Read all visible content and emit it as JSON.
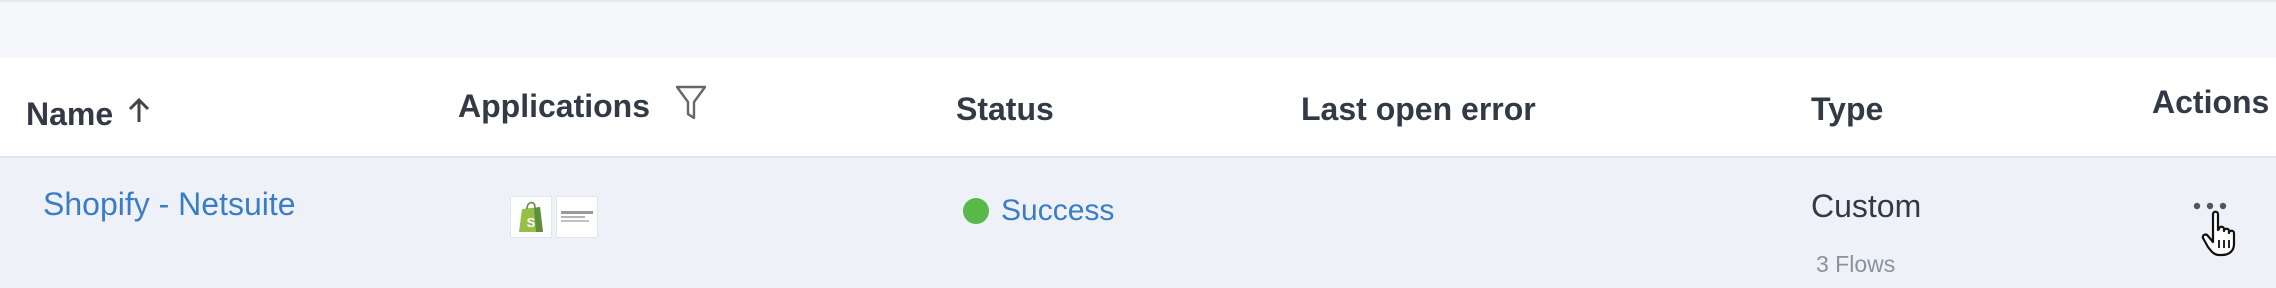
{
  "table": {
    "headers": {
      "name": "Name",
      "applications": "Applications",
      "status": "Status",
      "last_open_error": "Last open error",
      "type": "Type",
      "actions": "Actions"
    },
    "rows": [
      {
        "name": "Shopify - Netsuite",
        "applications": [
          "shopify-logo",
          "oracle-netsuite-logo"
        ],
        "status": "Success",
        "last_open_error": "",
        "type": "Custom",
        "flows": "3 Flows"
      }
    ]
  },
  "colors": {
    "link": "#3b7dc4",
    "success": "#59b84a",
    "row_background": "#eef2f8",
    "header_text": "#333a45"
  },
  "icons": {
    "sort": "arrow-up-icon",
    "filter": "funnel-icon",
    "actions": "ellipsis-icon",
    "cursor": "hand-pointer-icon"
  }
}
